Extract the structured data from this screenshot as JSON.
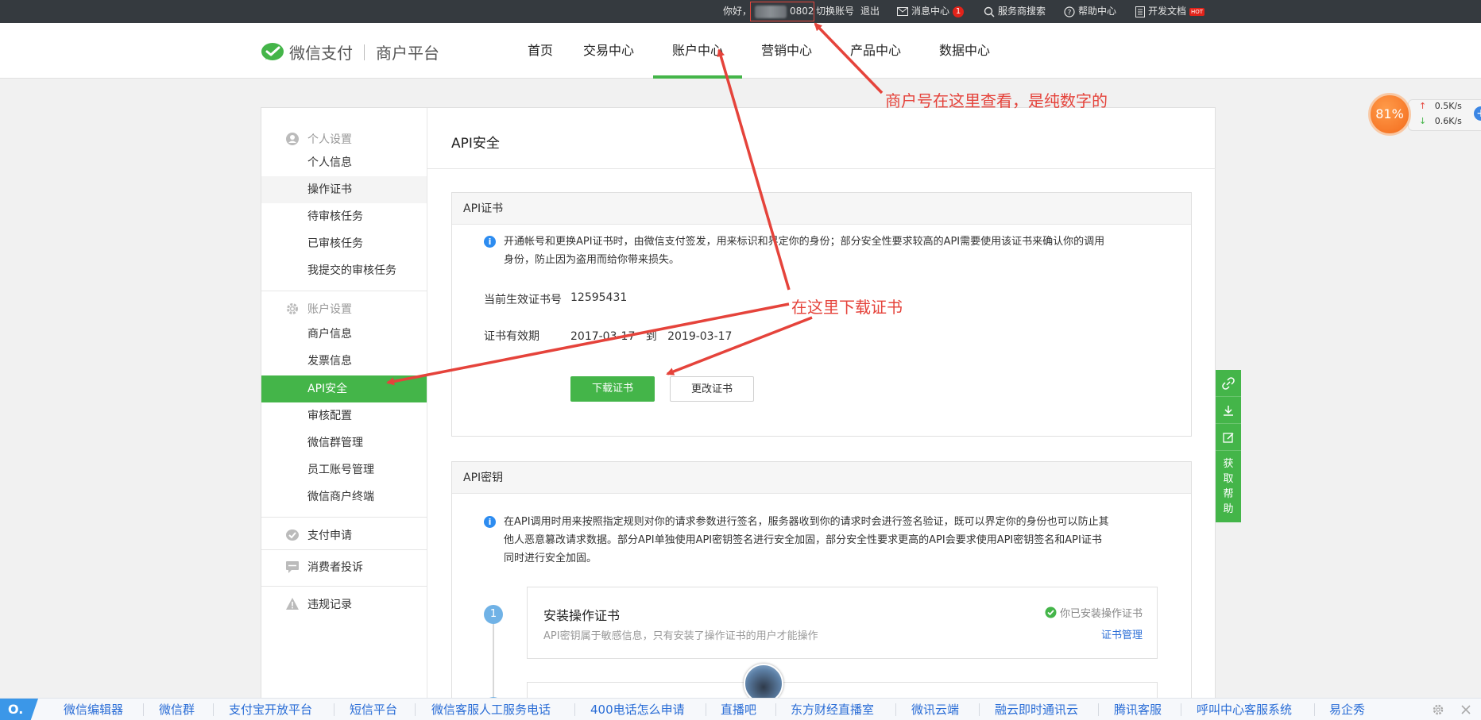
{
  "topbar": {
    "greeting": "你好，",
    "account_suffix": "0802",
    "switch_account": "切换账号",
    "logout": "退出",
    "message_center": "消息中心",
    "message_count": "1",
    "provider_search": "服务商搜索",
    "help_center": "帮助中心",
    "dev_docs": "开发文档",
    "hot_badge": "HOT"
  },
  "header": {
    "brand": "微信支付",
    "brand_sub": "商户平台",
    "nav": [
      "首页",
      "交易中心",
      "账户中心",
      "营销中心",
      "产品中心",
      "数据中心"
    ],
    "active_nav": "账户中心"
  },
  "annotations": {
    "merchant_id_note": "商户号在这里查看，是纯数字的",
    "download_note": "在这里下载证书"
  },
  "speed_widget": {
    "percent": "81%",
    "up": "0.5K/s",
    "down": "0.6K/s"
  },
  "sidebar": {
    "personal_group": "个人设置",
    "personal_items": [
      "个人信息",
      "操作证书",
      "待审核任务",
      "已审核任务",
      "我提交的审核任务"
    ],
    "account_group": "账户设置",
    "account_items": [
      "商户信息",
      "发票信息",
      "API安全",
      "审核配置",
      "微信群管理",
      "员工账号管理",
      "微信商户终端"
    ],
    "active_item": "API安全",
    "pay_apply": "支付申请",
    "complaints": "消费者投诉",
    "violations": "违规记录"
  },
  "content": {
    "page_title": "API安全",
    "cert_box": {
      "title": "API证书",
      "info_line1": "开通帐号和更换API证书时，由微信支付签发，用来标识和界定你的身份；部分安全性要求较高的API需要使用该证书来确认你的调用",
      "info_line2": "身份，防止因为盗用而给你带来损失。",
      "cert_no_label": "当前生效证书号",
      "cert_no": "12595431",
      "validity_label": "证书有效期",
      "valid_from": "2017-03-17",
      "to": "到",
      "valid_to": "2019-03-17",
      "download_button": "下载证书",
      "change_button": "更改证书"
    },
    "key_box": {
      "title": "API密钥",
      "info_line1": "在API调用时用来按照指定规则对你的请求参数进行签名，服务器收到你的请求时会进行签名验证，既可以界定你的身份也可以防止其",
      "info_line2": "他人恶意篡改请求数据。部分API单独使用API密钥签名进行安全加固，部分安全性要求更高的API会要求使用API密钥签名和API证书",
      "info_line3": "同时进行安全加固。",
      "step1_number": "1",
      "step1_title": "安装操作证书",
      "step1_desc": "API密钥属于敏感信息，只有安装了操作证书的用户才能操作",
      "step1_status": "你已安装操作证书",
      "step1_link": "证书管理"
    }
  },
  "float_tools": {
    "help_chars": [
      "获",
      "取",
      "帮",
      "助"
    ]
  },
  "bottombar": {
    "logo": "O.",
    "links": [
      "微信编辑器",
      "微信群",
      "支付宝开放平台",
      "短信平台",
      "微信客服人工服务电话",
      "400电话怎么申请",
      "直播吧",
      "东方财经直播室",
      "微讯云端",
      "融云即时通讯云",
      "腾讯客服",
      "呼叫中心客服系统",
      "易企秀"
    ]
  },
  "colors": {
    "accent_green": "#44b549",
    "annotation_red": "#e5433b",
    "topbar_bg": "#353a3f",
    "link_blue": "#2a6dd6"
  }
}
